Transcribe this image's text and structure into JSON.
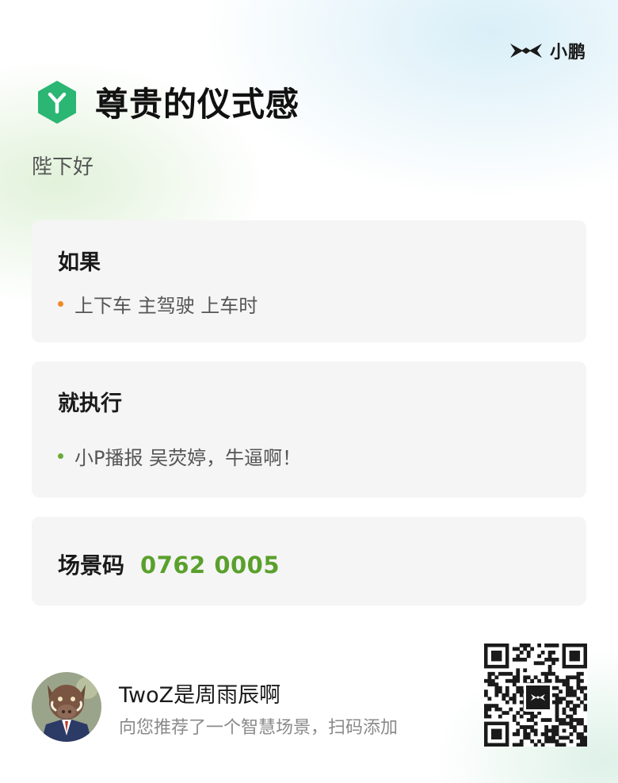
{
  "brand": {
    "name": "小鹏",
    "logo_icon": "xpeng-logo-icon"
  },
  "header": {
    "icon": "hexagon-y-icon",
    "title": "尊贵的仪式感"
  },
  "subtitle": "陛下好",
  "condition_card": {
    "heading": "如果",
    "items": [
      {
        "text": "上下车 主驾驶 上车时",
        "dot_color": "#f08a24"
      }
    ]
  },
  "action_card": {
    "heading": "就执行",
    "items": [
      {
        "text": "小P播报 吴荧婷，牛逼啊！",
        "dot_color": "#6aaa3a"
      }
    ]
  },
  "scene_code": {
    "label": "场景码",
    "value": "0762 0005"
  },
  "sharer": {
    "name": "TwoZ是周雨辰啊",
    "description": "向您推荐了一个智慧场景，扫码添加",
    "avatar": "boar-avatar-icon"
  },
  "qr": {
    "icon": "qr-code-icon",
    "center_icon": "xpeng-logo-icon"
  },
  "colors": {
    "accent_green": "#5aa02c",
    "hex_icon": "#2bb673",
    "card_bg": "#f5f5f5"
  }
}
